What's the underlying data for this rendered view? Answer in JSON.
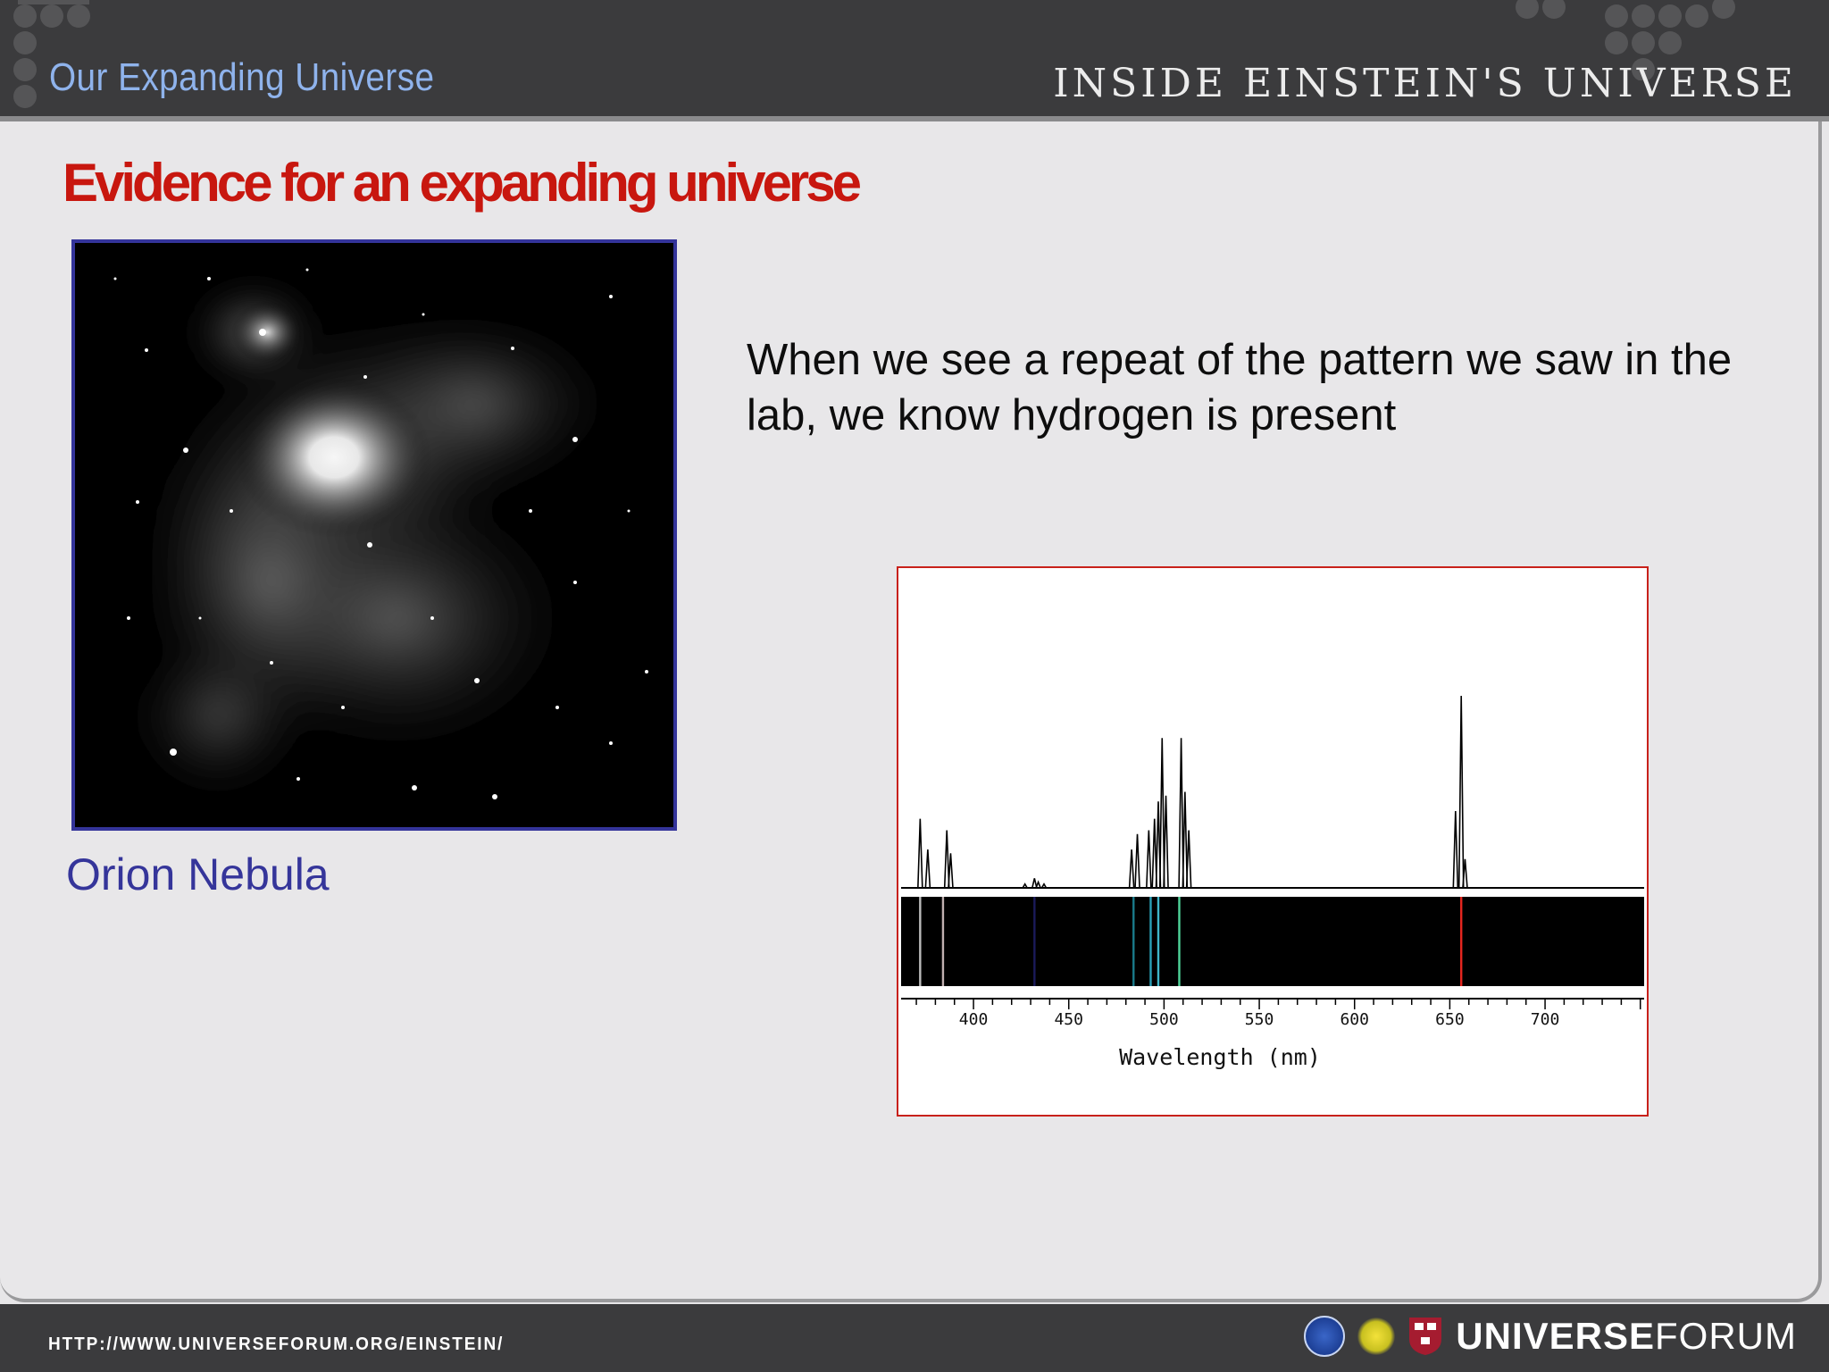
{
  "header": {
    "section_title": "Our Expanding Universe",
    "brand_title": "INSIDE EINSTEIN'S UNIVERSE"
  },
  "slide": {
    "heading": "Evidence for an expanding universe",
    "image_caption": "Orion Nebula",
    "body_text": "When we see a repeat of the pattern we saw in the lab, we know hydrogen is present"
  },
  "chart_data": {
    "type": "line",
    "xlabel": "Wavelength (nm)",
    "ylabel": "",
    "xlim": [
      362,
      752
    ],
    "ticks_labeled": [
      400,
      450,
      500,
      550,
      600,
      650,
      700
    ],
    "series": [
      {
        "x": [
          372,
          376,
          386,
          388,
          427,
          432,
          434,
          437,
          483,
          486,
          492,
          495,
          497,
          499,
          501,
          509,
          511,
          513,
          653,
          656,
          658
        ],
        "y": [
          0.36,
          0.2,
          0.3,
          0.18,
          0.02,
          0.05,
          0.03,
          0.02,
          0.2,
          0.28,
          0.3,
          0.36,
          0.45,
          0.78,
          0.48,
          0.78,
          0.5,
          0.3,
          0.4,
          1.0,
          0.15
        ]
      }
    ],
    "emission_lines": [
      {
        "x": 372,
        "color": "#bdbdbd"
      },
      {
        "x": 384,
        "color": "#c0b0b0"
      },
      {
        "x": 432,
        "color": "#1b1b5a"
      },
      {
        "x": 484,
        "color": "#1a7a8a"
      },
      {
        "x": 493,
        "color": "#2aa0b8"
      },
      {
        "x": 497,
        "color": "#3fb5c8"
      },
      {
        "x": 508,
        "color": "#4fd49a"
      },
      {
        "x": 656,
        "color": "#e6261f"
      }
    ]
  },
  "footer": {
    "url": "HTTP://WWW.UNIVERSEFORUM.ORG/EINSTEIN/",
    "logo_bold": "UNIVERSE",
    "logo_thin": "FORUM"
  },
  "colors": {
    "heading_red": "#c8170f",
    "caption_blue": "#35359a",
    "section_blue": "#8fb3ec"
  }
}
